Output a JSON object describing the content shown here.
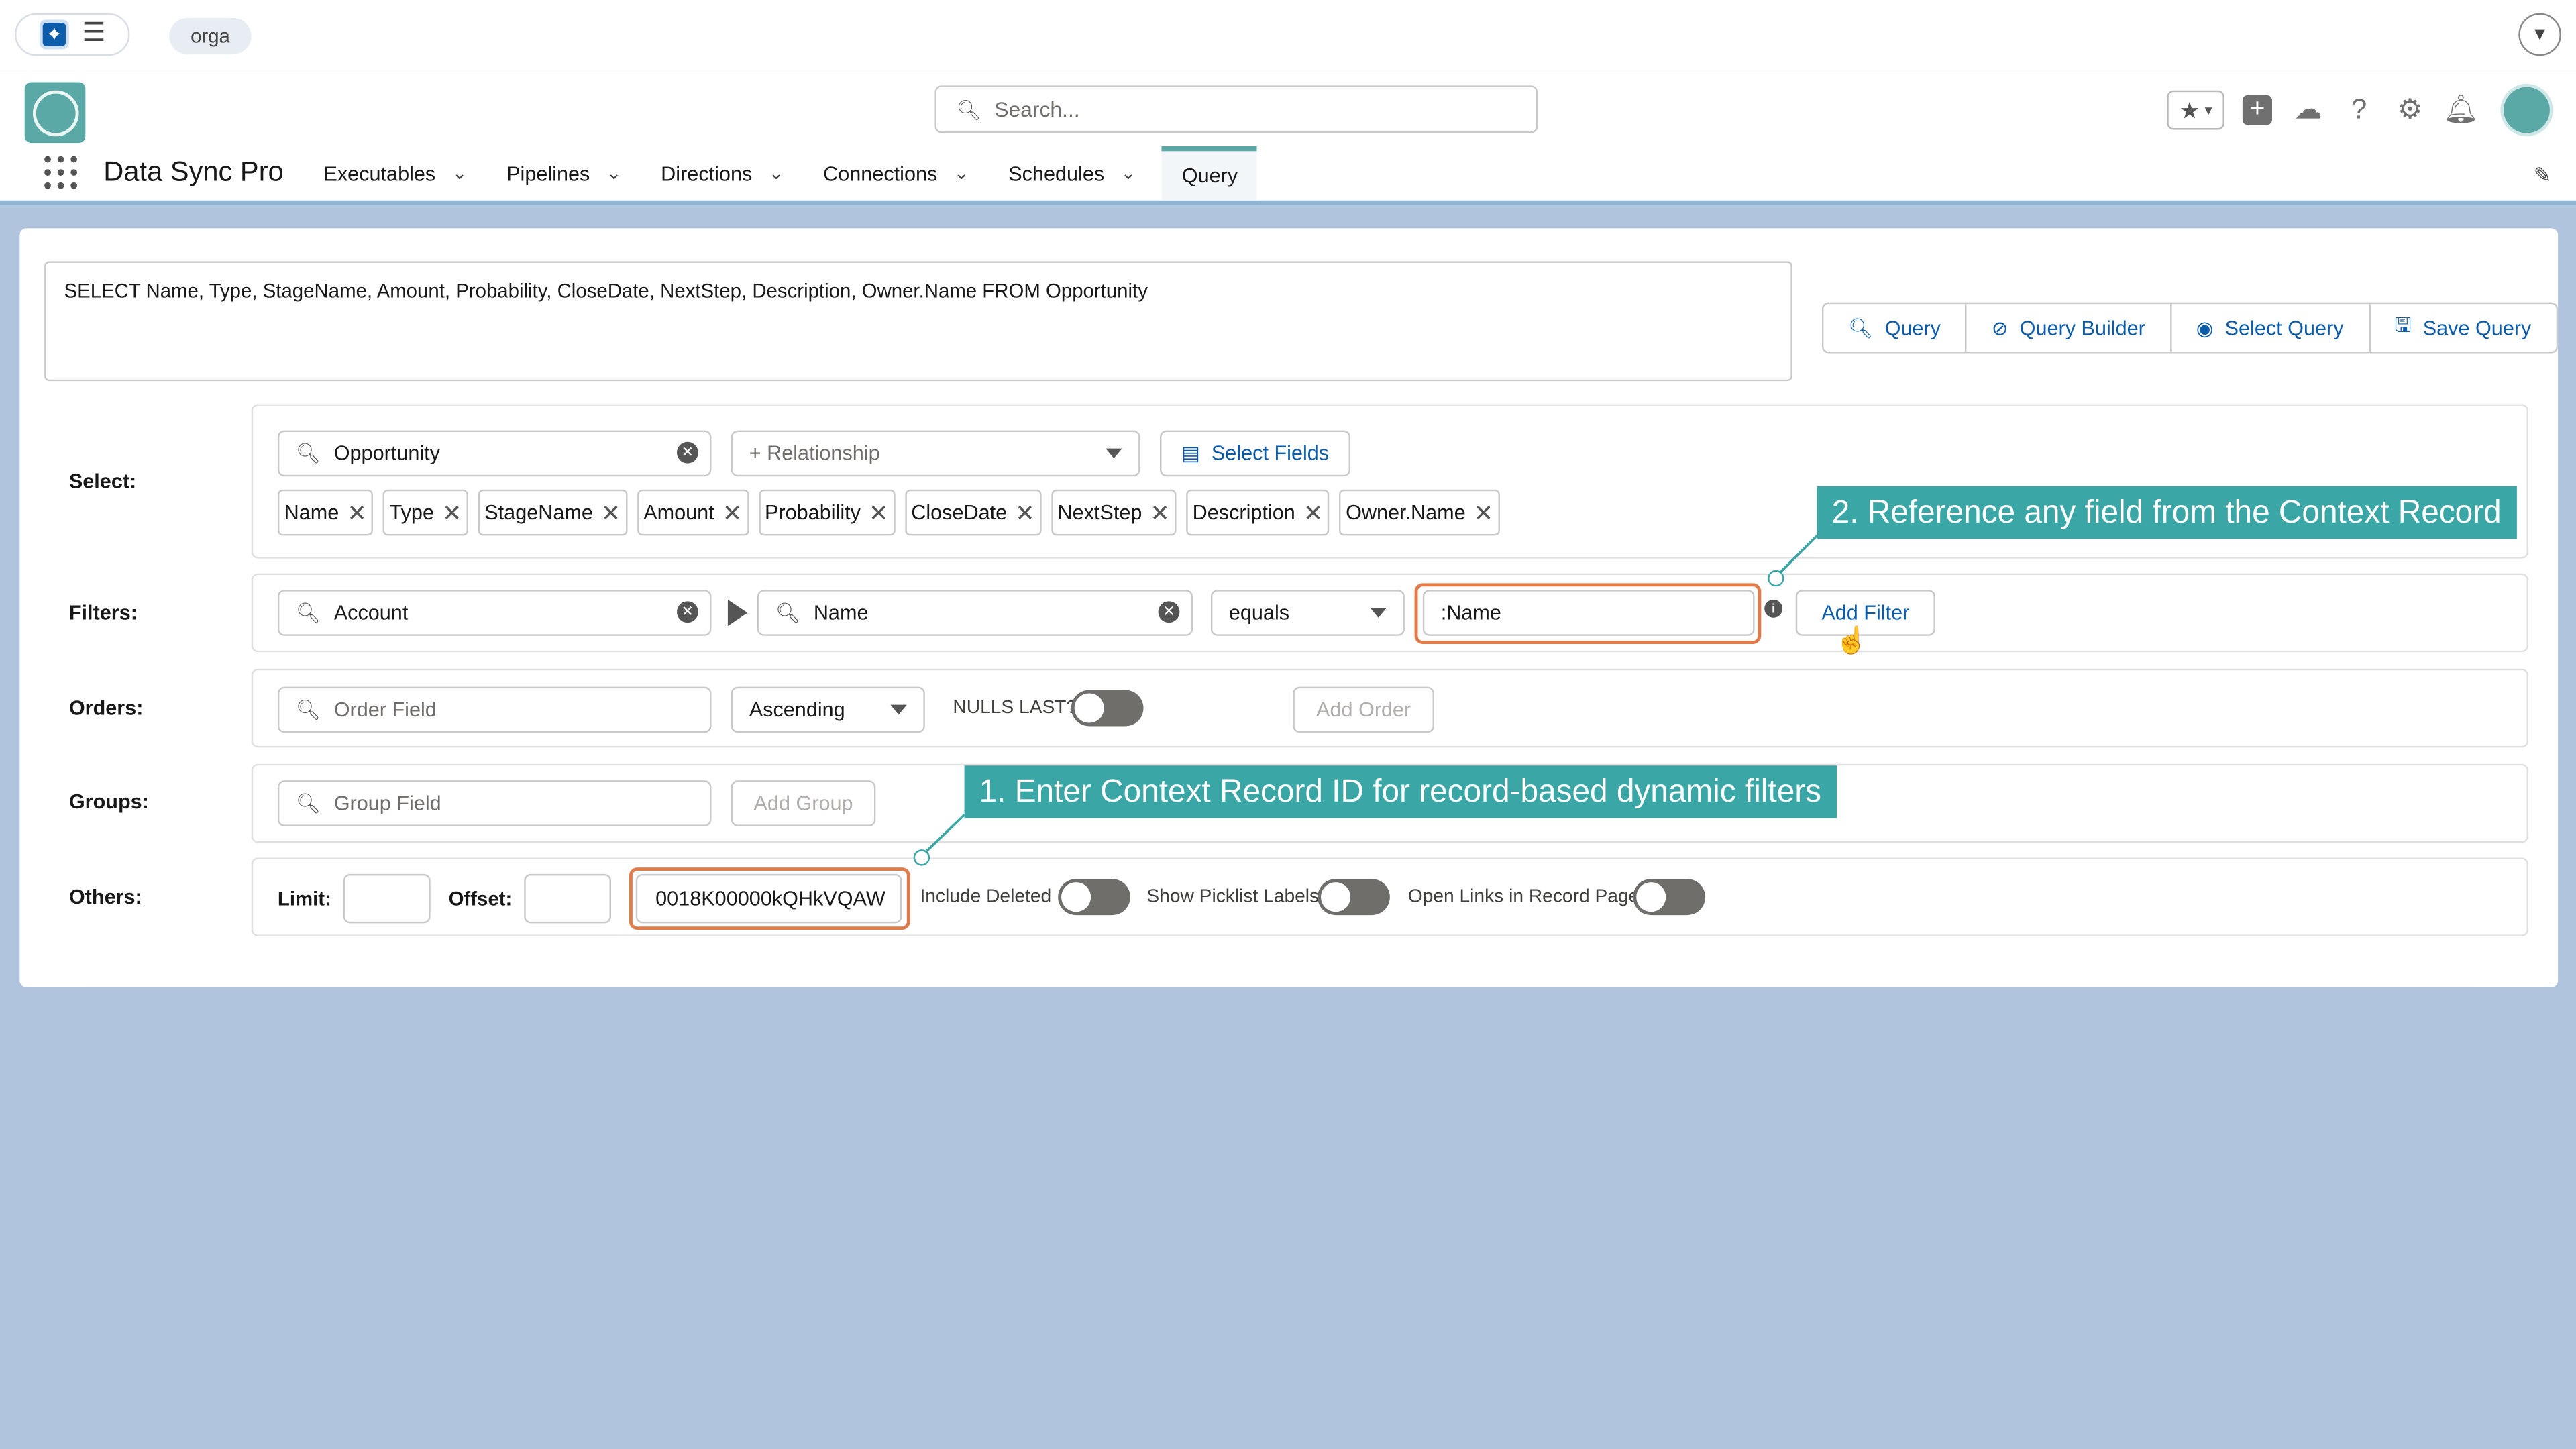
{
  "topbar": {
    "org": "orga"
  },
  "header": {
    "search_placeholder": "Search...",
    "app_name": "Data Sync Pro",
    "tabs": [
      {
        "label": "Executables",
        "has_menu": true
      },
      {
        "label": "Pipelines",
        "has_menu": true
      },
      {
        "label": "Directions",
        "has_menu": true
      },
      {
        "label": "Connections",
        "has_menu": true
      },
      {
        "label": "Schedules",
        "has_menu": true
      },
      {
        "label": "Query",
        "has_menu": false,
        "active": true
      }
    ]
  },
  "query": {
    "soql": "SELECT Name, Type, StageName, Amount, Probability, CloseDate, NextStep, Description, Owner.Name FROM Opportunity",
    "buttons": {
      "query": "Query",
      "builder": "Query Builder",
      "select": "Select Query",
      "save": "Save Query"
    }
  },
  "select": {
    "label": "Select:",
    "object": "Opportunity",
    "relationship_placeholder": "+ Relationship",
    "select_fields": "Select Fields",
    "fields": [
      "Name",
      "Type",
      "StageName",
      "Amount",
      "Probability",
      "CloseDate",
      "NextStep",
      "Description",
      "Owner.Name"
    ]
  },
  "filters": {
    "label": "Filters:",
    "object": "Account",
    "field": "Name",
    "operator": "equals",
    "value": ":Name",
    "add": "Add Filter"
  },
  "orders": {
    "label": "Orders:",
    "field_placeholder": "Order Field",
    "direction": "Ascending",
    "nulls_last": "NULLS LAST?",
    "add": "Add Order"
  },
  "groups": {
    "label": "Groups:",
    "field_placeholder": "Group Field",
    "add": "Add Group"
  },
  "others": {
    "label": "Others:",
    "limit_label": "Limit:",
    "offset_label": "Offset:",
    "context_record_id": "0018K00000kQHkVQAW",
    "include_deleted": "Include Deleted",
    "picklist_labels": "Show Picklist Labels",
    "open_links": "Open Links in Record Page"
  },
  "callouts": {
    "c1": "1. Enter Context Record ID for record-based dynamic filters",
    "c2": "2. Reference any field from the Context Record"
  },
  "colors": {
    "accent": "#3ba6a6",
    "highlight": "#e07b4a",
    "link": "#0b5cab",
    "background": "#b0c4de"
  }
}
